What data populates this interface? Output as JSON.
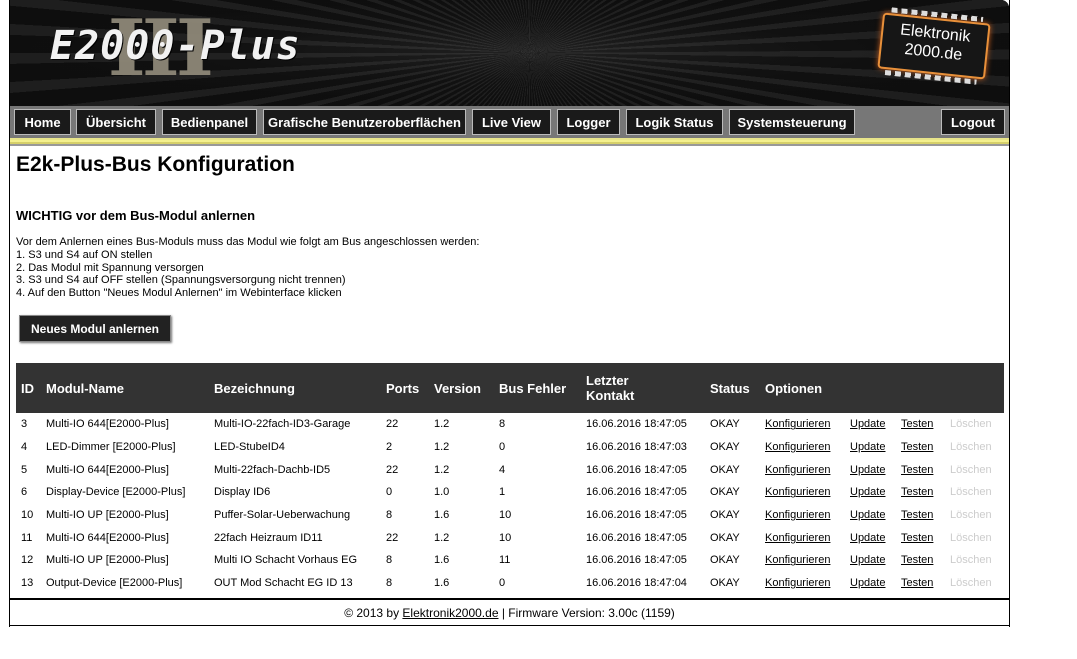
{
  "header": {
    "logo_text": "E2000-Plus",
    "logo_roman": "III",
    "chip_line1": "Elektronik",
    "chip_line2": "2000.de"
  },
  "nav": {
    "home": "Home",
    "overview": "Übersicht",
    "control_panel": "Bedienpanel",
    "graphic_ui": "Grafische Benutzeroberflächen",
    "live_view": "Live View",
    "logger": "Logger",
    "logic_status": "Logik Status",
    "system_control": "Systemsteuerung",
    "logout": "Logout"
  },
  "page": {
    "title": "E2k-Plus-Bus Konfiguration",
    "subtitle": "WICHTIG vor dem Bus-Modul anlernen",
    "intro": [
      "Vor dem Anlernen eines Bus-Moduls muss das Modul wie folgt am Bus angeschlossen werden:",
      "1. S3 und S4 auf ON stellen",
      "2. Das Modul mit Spannung versorgen",
      "3. S3 und S4 auf OFF stellen (Spannungsversorgung nicht trennen)",
      "4. Auf den Button \"Neues Modul Anlernen\" im Webinterface klicken"
    ],
    "new_module_button": "Neues Modul anlernen"
  },
  "table": {
    "headers": {
      "id": "ID",
      "name": "Modul-Name",
      "designation": "Bezeichnung",
      "ports": "Ports",
      "version": "Version",
      "bus_errors": "Bus Fehler",
      "last_contact_1": "Letzter",
      "last_contact_2": "Kontakt",
      "status": "Status",
      "options": "Optionen"
    },
    "action_labels": {
      "configure": "Konfigurieren",
      "update": "Update",
      "test": "Testen",
      "delete": "Löschen"
    },
    "rows": [
      {
        "id": "3",
        "name": "Multi-IO 644[E2000-Plus]",
        "designation": "Multi-IO-22fach-ID3-Garage",
        "ports": "22",
        "version": "1.2",
        "bus_errors": "8",
        "last_contact": "16.06.2016 18:47:05",
        "status": "OKAY"
      },
      {
        "id": "4",
        "name": "LED-Dimmer [E2000-Plus]",
        "designation": "LED-StubeID4",
        "ports": "2",
        "version": "1.2",
        "bus_errors": "0",
        "last_contact": "16.06.2016 18:47:03",
        "status": "OKAY"
      },
      {
        "id": "5",
        "name": "Multi-IO 644[E2000-Plus]",
        "designation": "Multi-22fach-Dachb-ID5",
        "ports": "22",
        "version": "1.2",
        "bus_errors": "4",
        "last_contact": "16.06.2016 18:47:05",
        "status": "OKAY"
      },
      {
        "id": "6",
        "name": "Display-Device [E2000-Plus]",
        "designation": "Display ID6",
        "ports": "0",
        "version": "1.0",
        "bus_errors": "1",
        "last_contact": "16.06.2016 18:47:05",
        "status": "OKAY"
      },
      {
        "id": "10",
        "name": "Multi-IO UP [E2000-Plus]",
        "designation": "Puffer-Solar-Ueberwachung",
        "ports": "8",
        "version": "1.6",
        "bus_errors": "10",
        "last_contact": "16.06.2016 18:47:05",
        "status": "OKAY"
      },
      {
        "id": "11",
        "name": "Multi-IO 644[E2000-Plus]",
        "designation": "22fach Heizraum ID11",
        "ports": "22",
        "version": "1.2",
        "bus_errors": "10",
        "last_contact": "16.06.2016 18:47:05",
        "status": "OKAY"
      },
      {
        "id": "12",
        "name": "Multi-IO UP [E2000-Plus]",
        "designation": "Multi IO Schacht Vorhaus EG",
        "ports": "8",
        "version": "1.6",
        "bus_errors": "11",
        "last_contact": "16.06.2016 18:47:05",
        "status": "OKAY"
      },
      {
        "id": "13",
        "name": "Output-Device [E2000-Plus]",
        "designation": "OUT Mod Schacht EG ID 13",
        "ports": "8",
        "version": "1.6",
        "bus_errors": "0",
        "last_contact": "16.06.2016 18:47:04",
        "status": "OKAY"
      }
    ]
  },
  "footer": {
    "prefix": "© 2013 by ",
    "link": "Elektronik2000.de",
    "suffix": " | Firmware Version: 3.00c (1159)"
  }
}
